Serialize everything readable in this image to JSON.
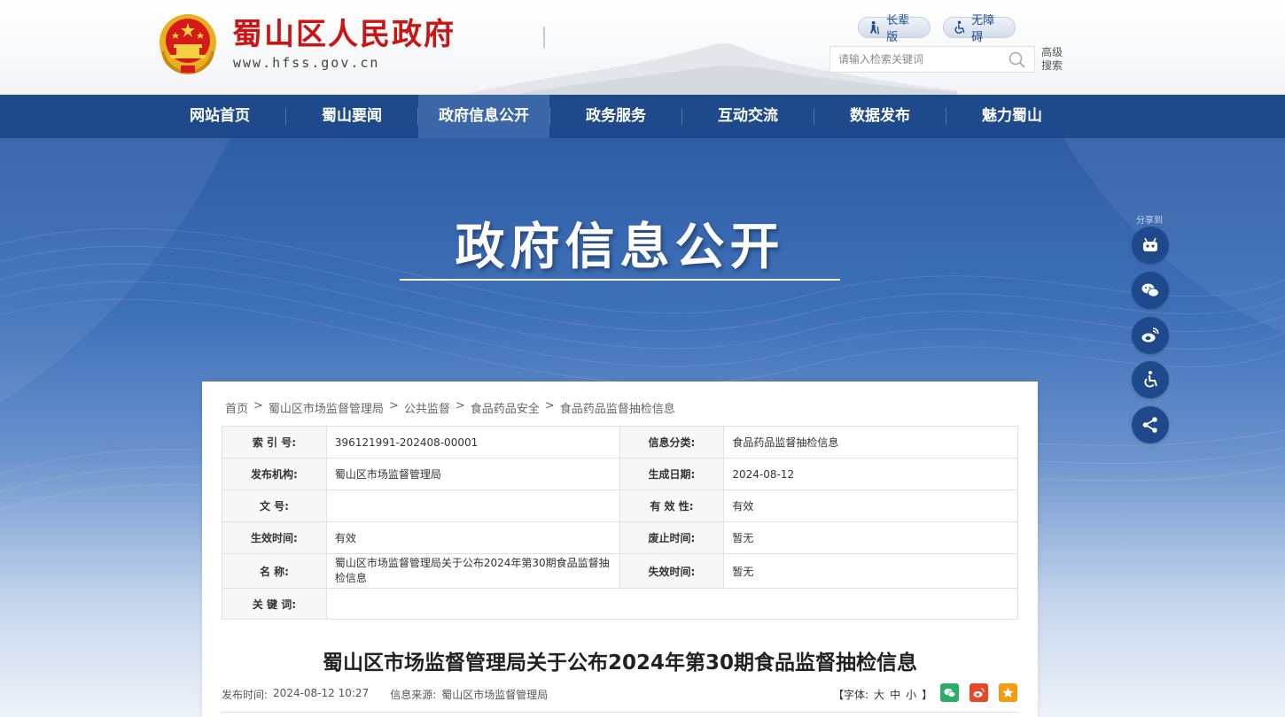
{
  "header": {
    "site_name": "蜀山区人民政府",
    "site_url": "www.hfss.gov.cn",
    "elder_mode": "长辈版",
    "accessibility": "无障碍",
    "search_placeholder": "请输入检索关键词",
    "advanced_search": "高级搜索"
  },
  "nav": {
    "items": [
      "网站首页",
      "蜀山要闻",
      "政府信息公开",
      "政务服务",
      "互动交流",
      "数据发布",
      "魅力蜀山"
    ],
    "active_index": 2
  },
  "banner": {
    "title": "政府信息公开"
  },
  "side_bar": {
    "label": "分享到",
    "buttons": [
      "robot-icon",
      "wechat-icon",
      "weibo-icon",
      "accessibility-icon",
      "share-icon"
    ]
  },
  "breadcrumb": [
    "首页",
    "蜀山区市场监督管理局",
    "公共监督",
    "食品药品安全",
    "食品药品监督抽检信息"
  ],
  "meta": {
    "index_no_label": "索 引 号:",
    "index_no": "396121991-202408-00001",
    "category_label": "信息分类:",
    "category": "食品药品监督抽检信息",
    "publisher_label": "发布机构:",
    "publisher": "蜀山区市场监督管理局",
    "created_label": "生成日期:",
    "created": "2024-08-12",
    "doc_no_label": "文 号:",
    "doc_no": "",
    "validity_label": "有 效 性:",
    "validity": "有效",
    "effective_label": "生效时间:",
    "effective": "有效",
    "abolish_label": "废止时间:",
    "abolish": "暂无",
    "name_label": "名 称:",
    "name": "蜀山区市场监督管理局关于公布2024年第30期食品监督抽检信息",
    "expire_label": "失效时间:",
    "expire": "暂无",
    "keywords_label": "关 键 词:",
    "keywords": ""
  },
  "document": {
    "title": "蜀山区市场监督管理局关于公布2024年第30期食品监督抽检信息",
    "publish_label": "发布时间:",
    "publish_time": "2024-08-12 10:27",
    "source_label": "信息来源:",
    "source": "蜀山区市场监督管理局",
    "font_label": "【字体:",
    "font_large": "大",
    "font_medium": "中",
    "font_small": "小",
    "font_close": "】"
  },
  "colors": {
    "nav_bg": "#1e4a8c",
    "nav_active": "#3b67a8",
    "brand_red": "#cc1414",
    "wechat": "#2aae67",
    "weibo": "#e6472a",
    "favorite": "#f39c12"
  }
}
